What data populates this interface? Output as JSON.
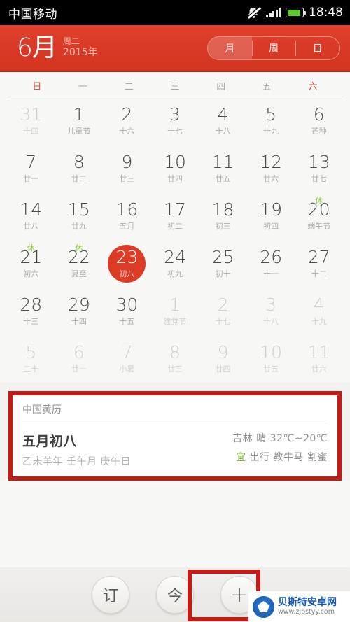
{
  "status_bar": {
    "carrier": "中国移动",
    "clock": "18:48",
    "icons": [
      "mute-bell-icon",
      "signal-bars-icon",
      "battery-icon"
    ]
  },
  "header": {
    "month": "6月",
    "weekday": "周二",
    "year": "2015年",
    "view_modes": [
      {
        "label": "月",
        "active": true
      },
      {
        "label": "周",
        "active": false
      },
      {
        "label": "日",
        "active": false
      }
    ],
    "accent_color": "#d93a27"
  },
  "calendar": {
    "weekday_headers": [
      "日",
      "一",
      "二",
      "三",
      "四",
      "五",
      "六"
    ],
    "rest_badge": "休",
    "rest_color": "#8cc63e",
    "selected_color": "#dc3c26",
    "weeks": [
      [
        {
          "num": "31",
          "lunar": "十四",
          "dim": true
        },
        {
          "num": "1",
          "lunar": "儿童节",
          "dim": false
        },
        {
          "num": "2",
          "lunar": "十六",
          "dim": false
        },
        {
          "num": "3",
          "lunar": "十七",
          "dim": false
        },
        {
          "num": "4",
          "lunar": "十八",
          "dim": false
        },
        {
          "num": "5",
          "lunar": "十九",
          "dim": false
        },
        {
          "num": "6",
          "lunar": "芒种",
          "dim": false
        }
      ],
      [
        {
          "num": "7",
          "lunar": "廿一",
          "dim": false
        },
        {
          "num": "8",
          "lunar": "廿二",
          "dim": false
        },
        {
          "num": "9",
          "lunar": "廿三",
          "dim": false
        },
        {
          "num": "10",
          "lunar": "廿四",
          "dim": false
        },
        {
          "num": "11",
          "lunar": "廿五",
          "dim": false
        },
        {
          "num": "12",
          "lunar": "廿六",
          "dim": false
        },
        {
          "num": "13",
          "lunar": "廿七",
          "dim": false
        }
      ],
      [
        {
          "num": "14",
          "lunar": "廿八",
          "dim": false
        },
        {
          "num": "15",
          "lunar": "廿九",
          "dim": false
        },
        {
          "num": "16",
          "lunar": "五月",
          "dim": false
        },
        {
          "num": "17",
          "lunar": "初二",
          "dim": false
        },
        {
          "num": "18",
          "lunar": "初三",
          "dim": false
        },
        {
          "num": "19",
          "lunar": "初四",
          "dim": false
        },
        {
          "num": "20",
          "lunar": "端午节",
          "dim": false,
          "rest": true
        }
      ],
      [
        {
          "num": "21",
          "lunar": "初六",
          "dim": false,
          "rest": true
        },
        {
          "num": "22",
          "lunar": "夏至",
          "dim": false,
          "rest": true
        },
        {
          "num": "23",
          "lunar": "初八",
          "dim": false,
          "selected": true
        },
        {
          "num": "24",
          "lunar": "初九",
          "dim": false
        },
        {
          "num": "25",
          "lunar": "初十",
          "dim": false
        },
        {
          "num": "26",
          "lunar": "十一",
          "dim": false
        },
        {
          "num": "27",
          "lunar": "十二",
          "dim": false
        }
      ],
      [
        {
          "num": "28",
          "lunar": "十三",
          "dim": false
        },
        {
          "num": "29",
          "lunar": "十四",
          "dim": false
        },
        {
          "num": "30",
          "lunar": "十五",
          "dim": false
        },
        {
          "num": "1",
          "lunar": "建党节",
          "dim": true
        },
        {
          "num": "2",
          "lunar": "十七",
          "dim": true
        },
        {
          "num": "3",
          "lunar": "十八",
          "dim": true
        },
        {
          "num": "4",
          "lunar": "十九",
          "dim": true
        }
      ],
      [
        {
          "num": "5",
          "lunar": "二十",
          "dim": true
        },
        {
          "num": "6",
          "lunar": "廿一",
          "dim": true
        },
        {
          "num": "7",
          "lunar": "小暑",
          "dim": true
        },
        {
          "num": "8",
          "lunar": "廿三",
          "dim": true
        },
        {
          "num": "9",
          "lunar": "廿四",
          "dim": true
        },
        {
          "num": "10",
          "lunar": "廿五",
          "dim": true
        },
        {
          "num": "11",
          "lunar": "廿六",
          "dim": true
        }
      ]
    ]
  },
  "info_panel": {
    "title": "中国黄历",
    "lunar_date": "五月初八",
    "ganzhi": "乙未羊年 壬午月 庚午日",
    "weather": "吉林 晴 32℃~20℃",
    "yi_tag": "宜",
    "yi_items": "出行 教牛马 割蜜",
    "highlight_color": "#c41b14"
  },
  "toolbar": {
    "buttons": [
      {
        "label": "订",
        "name": "subscribe-button"
      },
      {
        "label": "今",
        "name": "today-button"
      },
      {
        "label": "+",
        "name": "add-event-button"
      }
    ],
    "highlight_color": "#c41b14"
  },
  "watermark": {
    "name": "贝斯特安卓网",
    "url": "www.zjbstyy.com"
  }
}
